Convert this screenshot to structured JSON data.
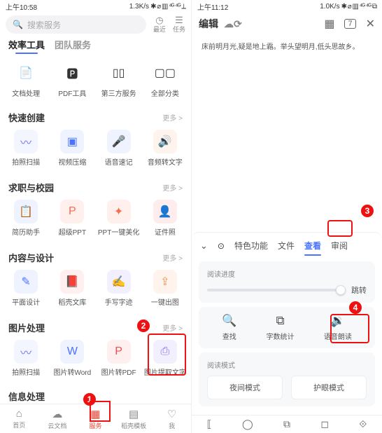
{
  "left": {
    "status": {
      "time": "上午10:58",
      "net": "1.3K/s",
      "icons": "✱ ⌀ ▥ ⁴ᴳ ⁴ᴳ ⟂"
    },
    "search_placeholder": "搜索服务",
    "quick": [
      {
        "glyph": "◷",
        "label": "最近"
      },
      {
        "glyph": "☰",
        "label": "任务"
      }
    ],
    "tabs": [
      "效率工具",
      "团队服务"
    ],
    "tabs_active": 0,
    "topgrid": [
      {
        "glyph": "📄",
        "label": "文档处理"
      },
      {
        "glyph": "🅿",
        "label": "PDF工具"
      },
      {
        "glyph": "▯▯",
        "label": "第三方服务"
      },
      {
        "glyph": "▢▢",
        "label": "全部分类"
      }
    ],
    "sections": [
      {
        "title": "快速创建",
        "more": "更多 >",
        "items": [
          {
            "glyph": "〰",
            "label": "拍照扫描",
            "bg": "#f4f6ff",
            "color": "#6d6dff"
          },
          {
            "glyph": "▣",
            "label": "视频压缩",
            "bg": "#eef3ff",
            "color": "#4a73ff"
          },
          {
            "glyph": "🎤",
            "label": "语音速记",
            "bg": "#eef3ff",
            "color": "#4a73ff"
          },
          {
            "glyph": "🔊",
            "label": "音频转文字",
            "bg": "#fff3ee",
            "color": "#f7944d"
          }
        ]
      },
      {
        "title": "求职与校园",
        "more": "更多 >",
        "items": [
          {
            "glyph": "📋",
            "label": "简历助手",
            "bg": "#eef3ff",
            "color": "#4a73ff"
          },
          {
            "glyph": "P",
            "label": "超级PPT",
            "bg": "#fff0ee",
            "color": "#f76d4d"
          },
          {
            "glyph": "✦",
            "label": "PPT一键美化",
            "bg": "#fff0ee",
            "color": "#f76d4d"
          },
          {
            "glyph": "👤",
            "label": "证件照",
            "bg": "#ffecec",
            "color": "#f14d4d"
          }
        ]
      },
      {
        "title": "内容与设计",
        "more": "更多 >",
        "items": [
          {
            "glyph": "✎",
            "label": "平面设计",
            "bg": "#eef3ff",
            "color": "#4a73ff"
          },
          {
            "glyph": "📕",
            "label": "稻壳文库",
            "bg": "#ffefef",
            "color": "#f14d4d"
          },
          {
            "glyph": "✍",
            "label": "手写字迹",
            "bg": "#f2f0ff",
            "color": "#8c6dff"
          },
          {
            "glyph": "⇪",
            "label": "一键出图",
            "bg": "#fff3ee",
            "color": "#f7944d"
          }
        ]
      },
      {
        "title": "图片处理",
        "more": "更多 >",
        "items": [
          {
            "glyph": "〰",
            "label": "拍照扫描",
            "bg": "#f4f6ff",
            "color": "#6d6dff"
          },
          {
            "glyph": "W",
            "label": "图片转Word",
            "bg": "#eef3ff",
            "color": "#4a73ff"
          },
          {
            "glyph": "P",
            "label": "图片转PDF",
            "bg": "#ffefef",
            "color": "#f14d4d"
          },
          {
            "glyph": "⎙",
            "label": "图片提取文字",
            "bg": "#f2f0ff",
            "color": "#8c6dff"
          }
        ]
      }
    ],
    "trunc_section": "信息处理",
    "nav": [
      {
        "glyph": "⌂",
        "label": "首页"
      },
      {
        "glyph": "☁",
        "label": "云文档"
      },
      {
        "glyph": "▦",
        "label": "服务"
      },
      {
        "glyph": "▤",
        "label": "稻壳模板"
      },
      {
        "glyph": "♡",
        "label": "我"
      }
    ],
    "nav_active": 2
  },
  "right": {
    "status": {
      "time": "上午11:12",
      "net": "1.0K/s",
      "icons": "✱ ⌀ ▥ ⁴ᴳ ⁴ᴳ ⧉"
    },
    "title": "编辑",
    "topicons": {
      "cloud": "☁⟳",
      "grid": "▦",
      "page": "7",
      "close": "✕"
    },
    "doc_text": "床前明月光,疑是地上霜。举头望明月,低头思故乡。",
    "sheet": {
      "chev": "⌄",
      "chat": "⊙",
      "tabs": [
        "特色功能",
        "文件",
        "查看",
        "审阅"
      ],
      "tabs_active": 2,
      "progress_label": "阅读进度",
      "jump": "跳转",
      "trio": [
        {
          "glyph": "🔍",
          "label": "查找"
        },
        {
          "glyph": "⧉",
          "label": "字数统计"
        },
        {
          "glyph": "🔉",
          "label": "语音朗读"
        }
      ],
      "mode_label": "阅读模式",
      "modes": [
        "夜间模式",
        "护眼模式"
      ]
    },
    "sysbar": [
      "⟦",
      "◯",
      "⧉",
      "◻",
      "⟐"
    ]
  },
  "anno": {
    "1": "1",
    "2": "2",
    "3": "3",
    "4": "4"
  }
}
